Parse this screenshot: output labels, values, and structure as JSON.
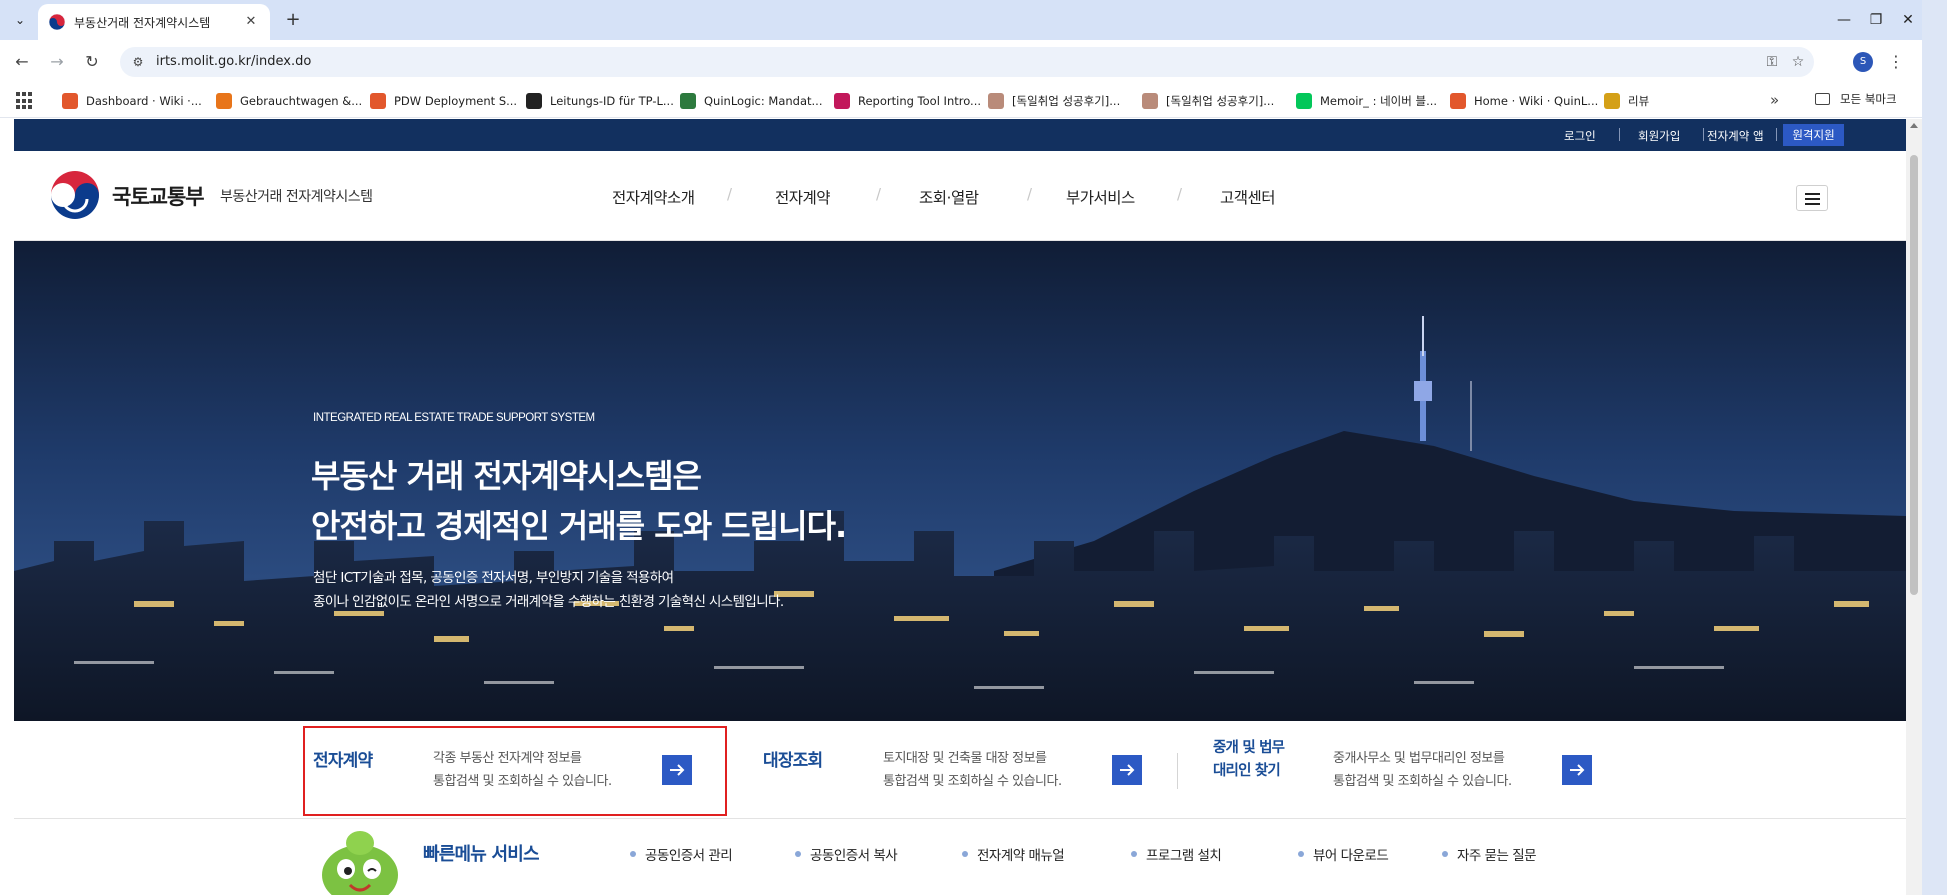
{
  "browser": {
    "tab_title": "부동산거래 전자계약시스템",
    "url": "irts.molit.go.kr/index.do",
    "profile_initial": "S",
    "bookmarks": [
      {
        "label": "Dashboard · Wiki ·...",
        "icon_color": "#e2572c"
      },
      {
        "label": "Gebrauchtwagen &...",
        "icon_color": "#e8751a"
      },
      {
        "label": "PDW Deployment S...",
        "icon_color": "#e2572c"
      },
      {
        "label": "Leitungs-ID für TP-L...",
        "icon_color": "#222222"
      },
      {
        "label": "QuinLogic: Mandat...",
        "icon_color": "#2d7a3e"
      },
      {
        "label": "Reporting Tool Intro...",
        "icon_color": "#c2185b"
      },
      {
        "label": "[독일취업 성공후기]...",
        "icon_color": "#b98b7a"
      },
      {
        "label": "[독일취업 성공후기]...",
        "icon_color": "#b98b7a"
      },
      {
        "label": "Memoir_ : 네이버 블...",
        "icon_color": "#03c75a"
      },
      {
        "label": "Home · Wiki · QuinL...",
        "icon_color": "#e2572c"
      },
      {
        "label": "리뷰",
        "icon_color": "#d4a017"
      }
    ],
    "more_bookmarks": "»",
    "all_bookmarks": "모든 북마크"
  },
  "utility": {
    "login": "로그인",
    "signup": "회원가입",
    "app": "전자계약 앱",
    "remote": "원격지원"
  },
  "header": {
    "ministry": "국토교통부",
    "system": "부동산거래 전자계약시스템",
    "menu": [
      "전자계약소개",
      "전자계약",
      "조회·열람",
      "부가서비스",
      "고객센터"
    ],
    "slash": "/"
  },
  "hero": {
    "eyebrow": "INTEGRATED REAL ESTATE TRADE SUPPORT SYSTEM",
    "headline_1": "부동산 거래 전자계약시스템은",
    "headline_2": "안전하고 경제적인 거래를 도와 드립니다.",
    "desc_1": "첨단 ICT기술과 접목, 공동인증 전자서명, 부인방지 기술을 적용하여",
    "desc_2": "종이나 인감없이도 온라인 서명으로 거래계약을 수행하는 친환경 기술혁신 시스템입니다."
  },
  "quick_cards": [
    {
      "title_1": "전자계약",
      "title_2": "",
      "desc_1": "각종 부동산 전자계약 정보를",
      "desc_2": "통합검색 및 조회하실 수 있습니다."
    },
    {
      "title_1": "대장조회",
      "title_2": "",
      "desc_1": "토지대장 및 건축물 대장 정보를",
      "desc_2": "통합검색 및 조회하실 수 있습니다."
    },
    {
      "title_1": "중개 및 법무",
      "title_2": "대리인 찾기",
      "desc_1": "중개사무소 및 법무대리인 정보를",
      "desc_2": "통합검색 및 조회하실 수 있습니다."
    }
  ],
  "fast_menu": {
    "title": "빠른메뉴 서비스",
    "items": [
      "공동인증서 관리",
      "공동인증서 복사",
      "전자계약 매뉴얼",
      "프로그램 설치",
      "뷰어 다운로드",
      "자주 묻는 질문"
    ]
  },
  "colors": {
    "utility_bar": "#12305f",
    "accent_blue": "#2c59c4",
    "title_blue": "#1a4d96",
    "highlight_red": "#e02020"
  }
}
